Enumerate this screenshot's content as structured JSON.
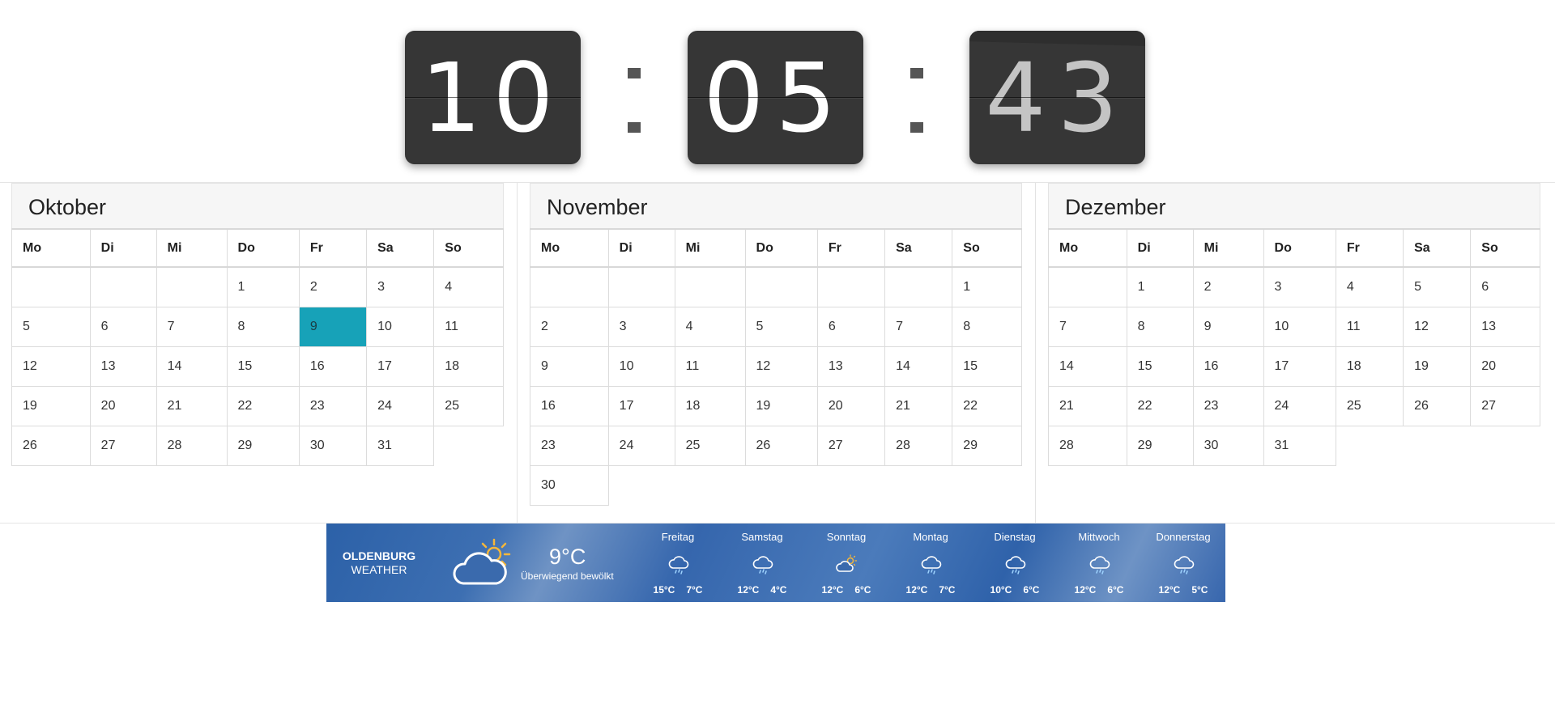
{
  "clock": {
    "hours": "10",
    "minutes": "05",
    "seconds": "43",
    "separator": ":"
  },
  "calendar": {
    "weekdays": [
      "Mo",
      "Di",
      "Mi",
      "Do",
      "Fr",
      "Sa",
      "So"
    ],
    "today_color": "#17a2b8",
    "months": [
      {
        "name": "Oktober",
        "weeks": [
          [
            "",
            "",
            "",
            "1",
            "2",
            "3",
            "4"
          ],
          [
            "5",
            "6",
            "7",
            "8",
            "9",
            "10",
            "11"
          ],
          [
            "12",
            "13",
            "14",
            "15",
            "16",
            "17",
            "18"
          ],
          [
            "19",
            "20",
            "21",
            "22",
            "23",
            "24",
            "25"
          ],
          [
            "26",
            "27",
            "28",
            "29",
            "30",
            "31",
            ""
          ]
        ],
        "today": "9"
      },
      {
        "name": "November",
        "weeks": [
          [
            "",
            "",
            "",
            "",
            "",
            "",
            "1"
          ],
          [
            "2",
            "3",
            "4",
            "5",
            "6",
            "7",
            "8"
          ],
          [
            "9",
            "10",
            "11",
            "12",
            "13",
            "14",
            "15"
          ],
          [
            "16",
            "17",
            "18",
            "19",
            "20",
            "21",
            "22"
          ],
          [
            "23",
            "24",
            "25",
            "26",
            "27",
            "28",
            "29"
          ],
          [
            "30",
            "",
            "",
            "",
            "",
            "",
            ""
          ]
        ]
      },
      {
        "name": "Dezember",
        "weeks": [
          [
            "",
            "1",
            "2",
            "3",
            "4",
            "5",
            "6"
          ],
          [
            "7",
            "8",
            "9",
            "10",
            "11",
            "12",
            "13"
          ],
          [
            "14",
            "15",
            "16",
            "17",
            "18",
            "19",
            "20"
          ],
          [
            "21",
            "22",
            "23",
            "24",
            "25",
            "26",
            "27"
          ],
          [
            "28",
            "29",
            "30",
            "31",
            "",
            "",
            ""
          ]
        ]
      }
    ]
  },
  "weather": {
    "city": "OLDENBURG",
    "label": "WEATHER",
    "current_temp": "9°C",
    "current_condition": "Überwiegend bewölkt",
    "current_icon": "partly-cloudy-icon",
    "days": [
      {
        "name": "Freitag",
        "icon": "rain-cloud-icon",
        "high": "15°C",
        "low": "7°C"
      },
      {
        "name": "Samstag",
        "icon": "rain-cloud-icon",
        "high": "12°C",
        "low": "4°C"
      },
      {
        "name": "Sonntag",
        "icon": "partly-cloudy-icon",
        "high": "12°C",
        "low": "6°C"
      },
      {
        "name": "Montag",
        "icon": "rain-cloud-icon",
        "high": "12°C",
        "low": "7°C"
      },
      {
        "name": "Dienstag",
        "icon": "rain-cloud-icon",
        "high": "10°C",
        "low": "6°C"
      },
      {
        "name": "Mittwoch",
        "icon": "rain-cloud-icon",
        "high": "12°C",
        "low": "6°C"
      },
      {
        "name": "Donnerstag",
        "icon": "rain-cloud-icon",
        "high": "12°C",
        "low": "5°C"
      }
    ]
  }
}
